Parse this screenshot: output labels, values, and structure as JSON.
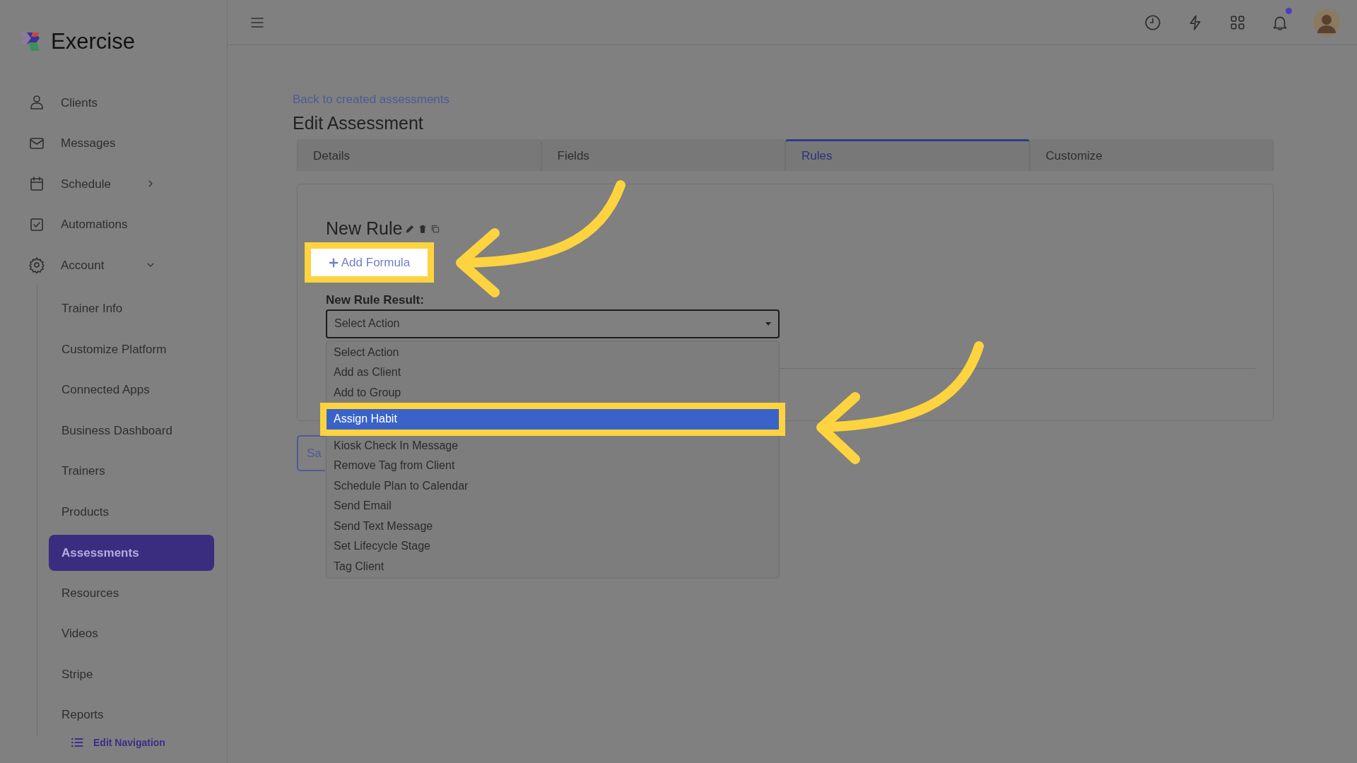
{
  "app": {
    "name": "Exercise"
  },
  "sidebar": {
    "items": [
      {
        "label": "Clients"
      },
      {
        "label": "Messages"
      },
      {
        "label": "Schedule",
        "expanded": false
      },
      {
        "label": "Automations"
      },
      {
        "label": "Account",
        "expanded": true,
        "children": [
          {
            "label": "Trainer Info",
            "selected": false
          },
          {
            "label": "Customize Platform",
            "selected": false
          },
          {
            "label": "Connected Apps",
            "selected": false
          },
          {
            "label": "Business Dashboard",
            "selected": false
          },
          {
            "label": "Trainers",
            "selected": false
          },
          {
            "label": "Products",
            "selected": false
          },
          {
            "label": "Assessments",
            "selected": true
          },
          {
            "label": "Resources",
            "selected": false
          },
          {
            "label": "Videos",
            "selected": false
          },
          {
            "label": "Stripe",
            "selected": false
          },
          {
            "label": "Reports",
            "selected": false
          }
        ]
      }
    ],
    "edit_navigation": "Edit Navigation"
  },
  "topbar": {
    "has_notification": true
  },
  "page": {
    "back_link": "Back to created assessments",
    "title": "Edit Assessment",
    "tabs": [
      {
        "label": "Details",
        "selected": false
      },
      {
        "label": "Fields",
        "selected": false
      },
      {
        "label": "Rules",
        "selected": true
      },
      {
        "label": "Customize",
        "selected": false
      }
    ],
    "rule": {
      "name": "New Rule",
      "add_formula": {
        "label": "Add Formula",
        "highlighted": true
      },
      "result_label": "New Rule Result:",
      "select": {
        "value": "Select Action",
        "open": true
      },
      "options": [
        {
          "label": "Select Action",
          "selected": false,
          "highlighted": false
        },
        {
          "label": "Add as Client",
          "selected": false,
          "highlighted": false
        },
        {
          "label": "Add to Group",
          "selected": false,
          "highlighted": false
        },
        {
          "label": "Assign Habit",
          "selected": true,
          "highlighted": true
        },
        {
          "label": "Kiosk Check In Message",
          "selected": false,
          "highlighted": false
        },
        {
          "label": "Remove Tag from Client",
          "selected": false,
          "highlighted": false
        },
        {
          "label": "Schedule Plan to Calendar",
          "selected": false,
          "highlighted": false
        },
        {
          "label": "Send Email",
          "selected": false,
          "highlighted": false
        },
        {
          "label": "Send Text Message",
          "selected": false,
          "highlighted": false
        },
        {
          "label": "Set Lifecycle Stage",
          "selected": false,
          "highlighted": false
        },
        {
          "label": "Tag Client",
          "selected": false,
          "highlighted": false
        }
      ]
    },
    "save_button": "Sa"
  }
}
